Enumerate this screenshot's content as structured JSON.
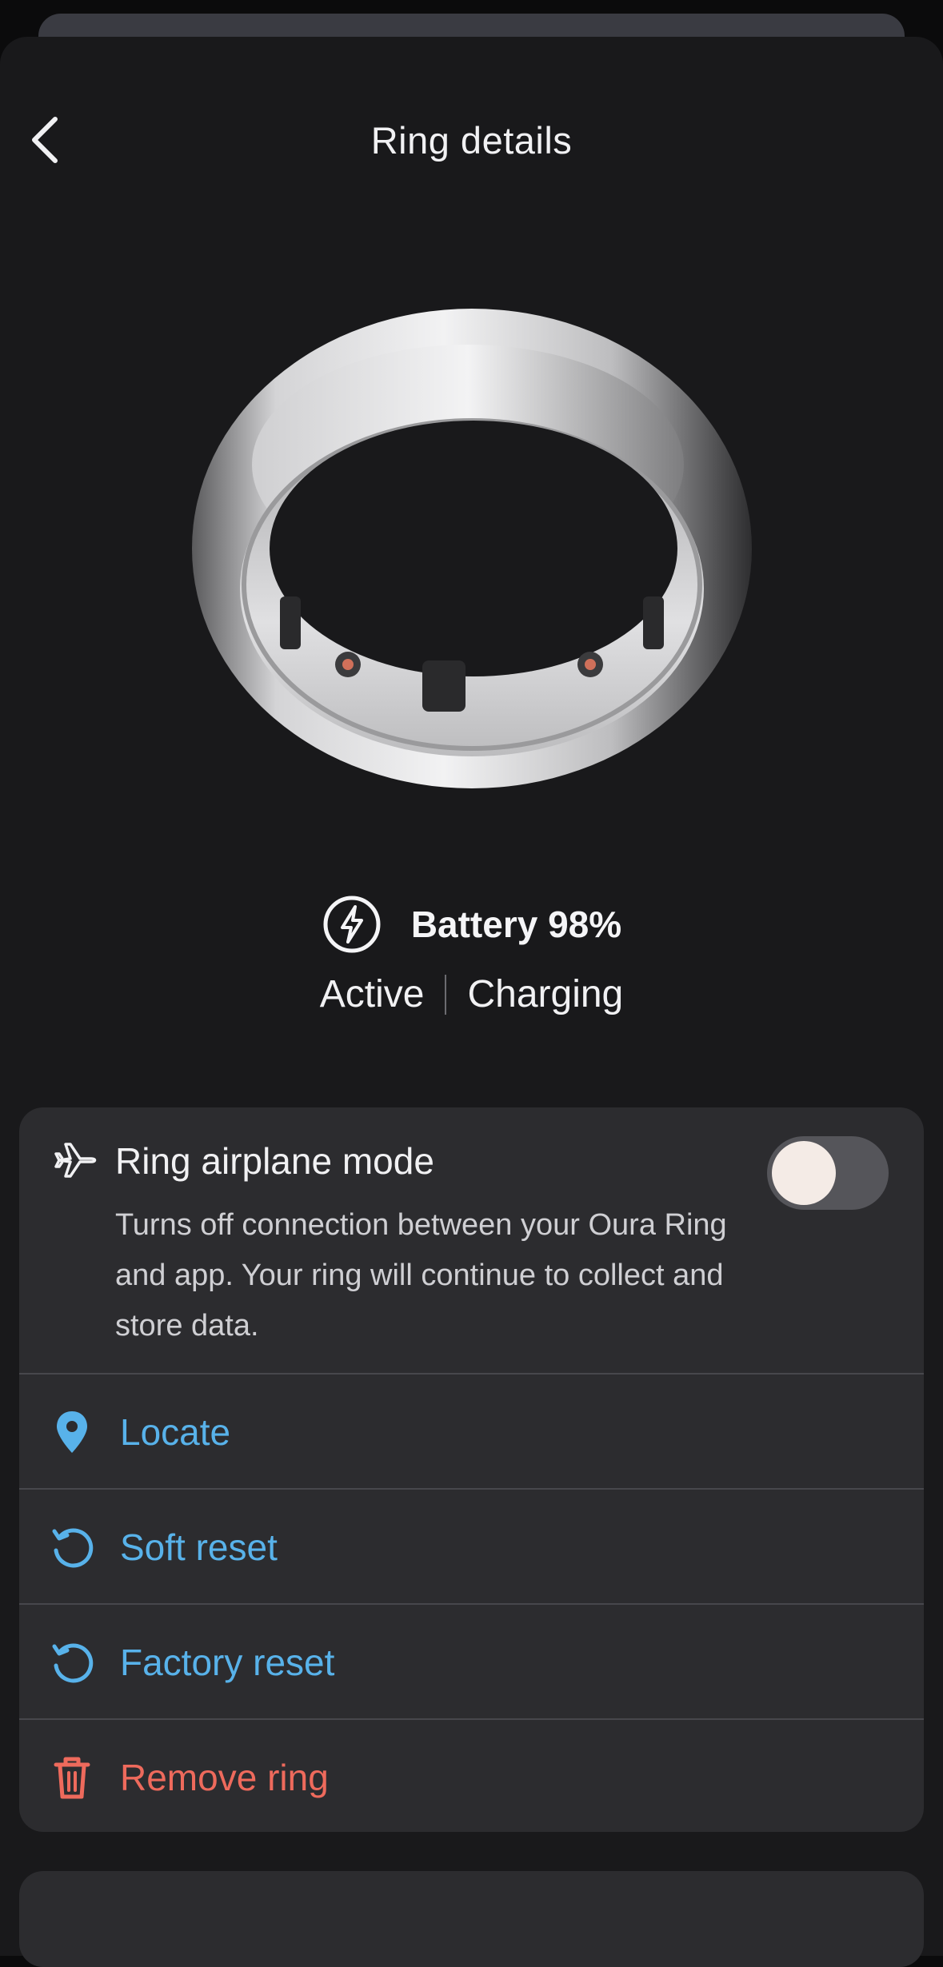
{
  "header": {
    "title": "Ring details"
  },
  "battery": {
    "label": "Battery 98%",
    "level_percent": 98
  },
  "status": {
    "state": "Active",
    "charging": "Charging"
  },
  "airplane_mode": {
    "title": "Ring airplane mode",
    "description": "Turns off connection between your Oura Ring and app. Your ring will continue to collect and store data.",
    "enabled": false
  },
  "actions": [
    {
      "label": "Locate",
      "icon": "location-pin-icon"
    },
    {
      "label": "Soft reset",
      "icon": "reset-icon"
    },
    {
      "label": "Factory reset",
      "icon": "reset-icon"
    },
    {
      "label": "Remove ring",
      "icon": "trash-icon"
    }
  ],
  "colors": {
    "background": "#19191b",
    "card": "#2c2c2f",
    "action_blue": "#58b2ea",
    "destructive_red": "#ee6a5c"
  }
}
